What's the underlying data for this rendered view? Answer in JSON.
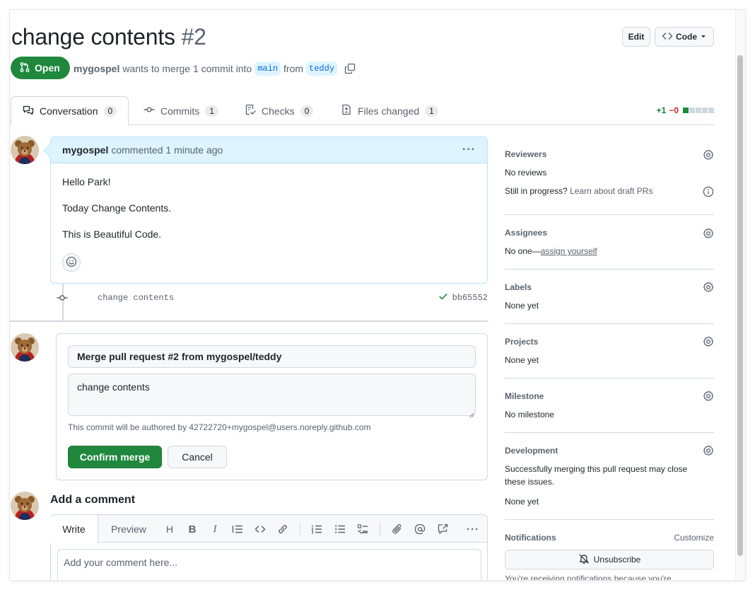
{
  "pr": {
    "title": "change contents",
    "number": "#2"
  },
  "header": {
    "edit_label": "Edit",
    "code_label": "Code"
  },
  "status": {
    "label": "Open"
  },
  "meta": {
    "author": "mygospel",
    "text": "wants to merge 1 commit into",
    "base": "main",
    "from_word": "from",
    "head": "teddy"
  },
  "tabs": [
    {
      "label": "Conversation",
      "count": "0"
    },
    {
      "label": "Commits",
      "count": "1"
    },
    {
      "label": "Checks",
      "count": "0"
    },
    {
      "label": "Files changed",
      "count": "1"
    }
  ],
  "diffstat": {
    "additions": "+1",
    "deletions": "−0"
  },
  "comment": {
    "author": "mygospel",
    "action": "commented 1 minute ago",
    "lines": [
      "Hello Park!",
      "Today Change Contents.",
      "This is Beautiful Code."
    ]
  },
  "commit": {
    "message": "change contents",
    "sha": "bb65552"
  },
  "merge": {
    "title_value": "Merge pull request #2 from mygospel/teddy",
    "message_value": "change contents",
    "note": "This commit will be authored by 42722720+mygospel@users.noreply.github.com",
    "confirm_label": "Confirm merge",
    "cancel_label": "Cancel"
  },
  "add_comment": {
    "heading": "Add a comment",
    "write_tab": "Write",
    "preview_tab": "Preview",
    "placeholder": "Add your comment here..."
  },
  "sidebar": {
    "reviewers": {
      "heading": "Reviewers",
      "value": "No reviews",
      "progress_text": "Still in progress?",
      "progress_link": "Learn about draft PRs"
    },
    "assignees": {
      "heading": "Assignees",
      "value_prefix": "No one—",
      "value_link": "assign yourself"
    },
    "labels": {
      "heading": "Labels",
      "value": "None yet"
    },
    "projects": {
      "heading": "Projects",
      "value": "None yet"
    },
    "milestone": {
      "heading": "Milestone",
      "value": "No milestone"
    },
    "development": {
      "heading": "Development",
      "line1": "Successfully merging this pull request may close",
      "line2": "these issues.",
      "value": "None yet"
    },
    "notifications": {
      "heading": "Notifications",
      "customize": "Customize",
      "unsubscribe": "Unsubscribe",
      "note": "You're receiving notifications because you're"
    }
  },
  "colors": {
    "accent_green": "#1f883d",
    "link_blue": "#0969da",
    "comment_header_bg": "#ddf4ff"
  }
}
